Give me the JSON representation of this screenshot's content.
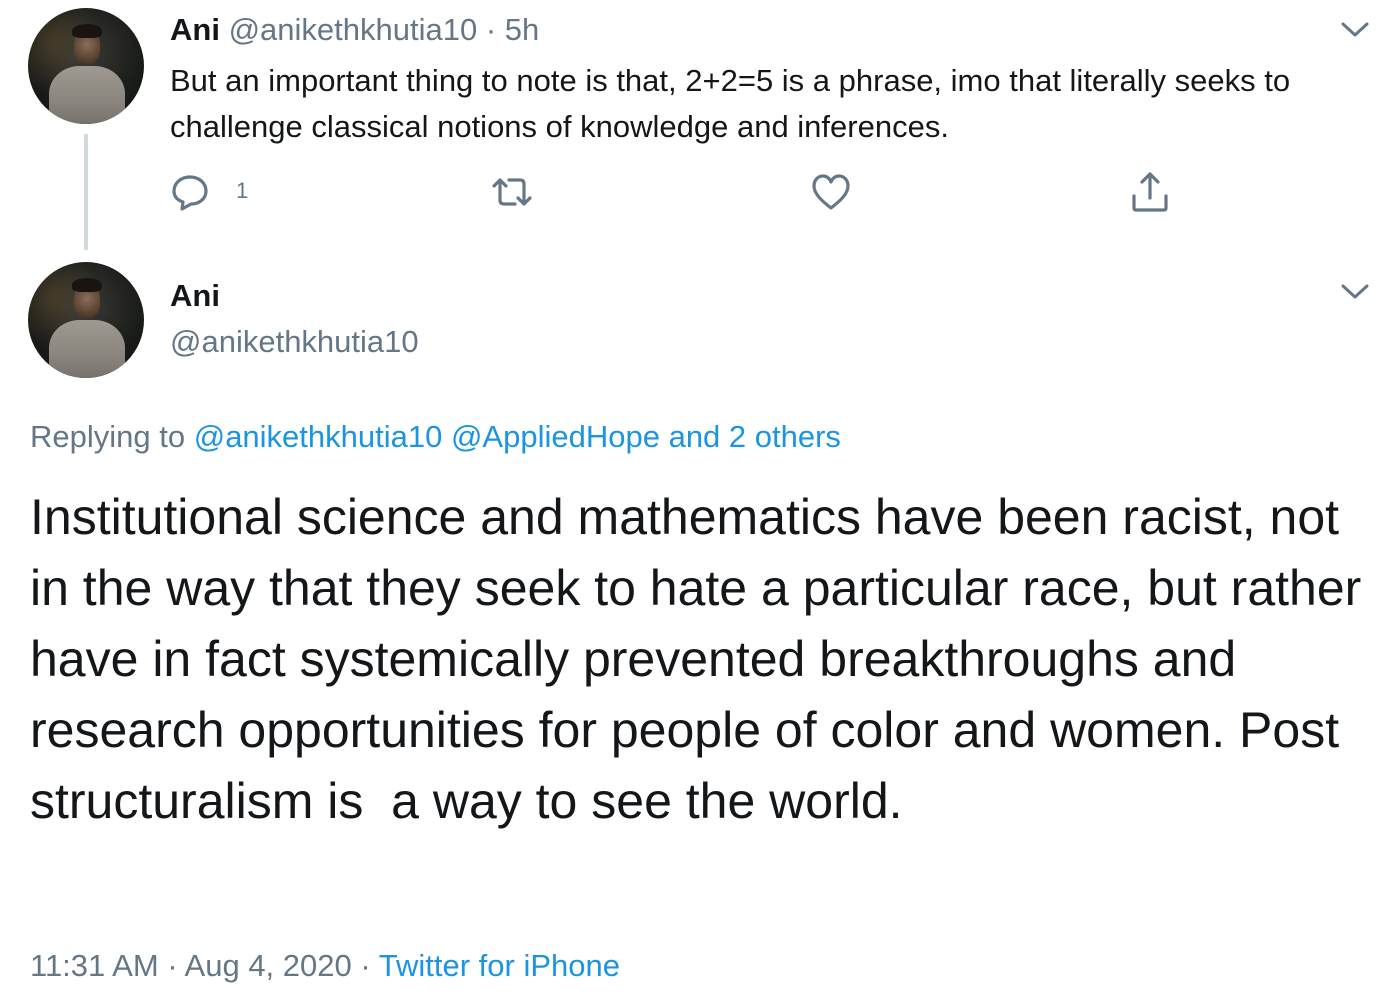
{
  "parent_tweet": {
    "author_name": "Ani",
    "author_handle": "@anikethkhutia10",
    "separator": "·",
    "time_ago": "5h",
    "text": "But an important thing to note is that, 2+2=5 is a phrase, imo that literally seeks to challenge classical notions of knowledge and inferences.",
    "reply_count": "1",
    "icons": {
      "avatar": "profile-photo",
      "menu": "chevron-down-icon",
      "reply": "reply-icon",
      "retweet": "retweet-icon",
      "like": "heart-icon",
      "share": "share-icon"
    }
  },
  "main_tweet": {
    "author_name": "Ani",
    "author_handle": "@anikethkhutia10",
    "replying_prefix": "Replying to",
    "replying_mentions": "@anikethkhutia10 @AppliedHope and 2 others",
    "text": "Institutional science and mathematics have been racist, not in the way that they seek to hate a particular race, but rather have in fact systemically prevented breakthroughs and research opportunities for people of color and women. Post structuralism is  a way to see the world.",
    "time": "11:31 AM",
    "separator1": "·",
    "date": "Aug 4, 2020",
    "separator2": "·",
    "source": "Twitter for iPhone"
  },
  "colors": {
    "text": "#14171a",
    "secondary": "#657786",
    "link": "#1b95e0",
    "thread_line": "#cfd9de"
  }
}
